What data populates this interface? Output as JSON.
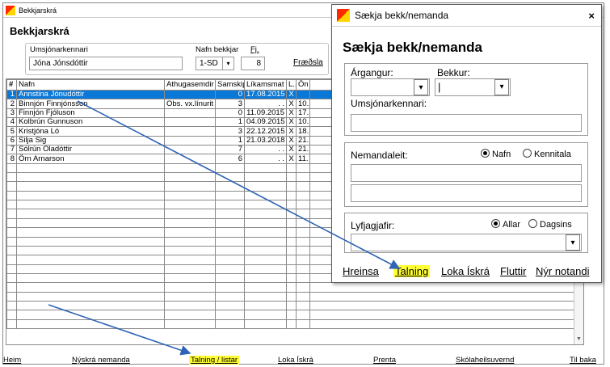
{
  "main": {
    "title": "Bekkjarskrá",
    "heading": "Bekkjarskrá",
    "filter": {
      "teacher_label": "Umsjónarkennari",
      "teacher_value": "Jóna Jónsdóttir",
      "class_label": "Nafn bekkjar",
      "class_value": "1-SD",
      "count_label": "Fj.",
      "count_value": "8",
      "link": "Fræðsla"
    },
    "columns": [
      "#",
      "Nafn",
      "Athugasemdir",
      "Samskipti",
      "Líkamsmat",
      "L...",
      "Ön"
    ],
    "rows": [
      {
        "n": "1",
        "name": "Annstina Jónudóttir",
        "note": "",
        "sam": "0",
        "date": "17.08.2015",
        "l": "X",
        "on": "",
        "selected": true
      },
      {
        "n": "2",
        "name": "Binnjón Finnjónsson",
        "note": "Obs. vx.línurit",
        "sam": "3",
        "date": ". .",
        "l": "X",
        "on": "10."
      },
      {
        "n": "3",
        "name": "Finnjón Fjóluson",
        "note": "",
        "sam": "0",
        "date": "11.09.2015",
        "l": "X",
        "on": "17."
      },
      {
        "n": "4",
        "name": "Kolbrún Gunnuson",
        "note": "",
        "sam": "1",
        "date": "04.09.2015",
        "l": "X",
        "on": "10."
      },
      {
        "n": "5",
        "name": "Kristjóna Ló",
        "note": "",
        "sam": "3",
        "date": "22.12.2015",
        "l": "X",
        "on": "18."
      },
      {
        "n": "6",
        "name": "Silja Sig",
        "note": "",
        "sam": "1",
        "date": "21.03.2018",
        "l": "X",
        "on": "21."
      },
      {
        "n": "7",
        "name": "Sólrún Óladóttir",
        "note": "",
        "sam": "7",
        "date": ". .",
        "l": "X",
        "on": "21."
      },
      {
        "n": "8",
        "name": "Örn Arnarson",
        "note": "",
        "sam": "6",
        "date": ". .",
        "l": "X",
        "on": "11."
      }
    ],
    "bottom": {
      "heim": "Heim",
      "nyskra": "Nýskrá nemanda",
      "talning": "Talning / listar",
      "loka": "Loka Ískrá",
      "prenta": "Prenta",
      "skola": "Skólaheilsuvernd",
      "tilbaka": "Til baka"
    }
  },
  "dialog": {
    "title": "Sækja bekk/nemanda",
    "close": "×",
    "heading": "Sækja bekk/nemanda",
    "argangur_label": "Árgangur:",
    "bekkur_label": "Bekkur:",
    "bekkur_value": "|",
    "umsjon_label": "Umsjónarkennari:",
    "nemandaleit_label": "Nemandaleit:",
    "radio_nafn": "Nafn",
    "radio_kennitala": "Kennitala",
    "lyfjagjafir_label": "Lyfjagjafir:",
    "radio_allar": "Allar",
    "radio_dagsins": "Dagsins",
    "links": {
      "hreinsa": "Hreinsa",
      "talning": "Talning",
      "loka": "Loka Ískrá",
      "fluttir": "Fluttir",
      "nyr": "Nýr notandi"
    }
  },
  "colors": {
    "selection": "#0a78d7",
    "highlight": "#ffff33",
    "arrow": "#2f63b5"
  }
}
